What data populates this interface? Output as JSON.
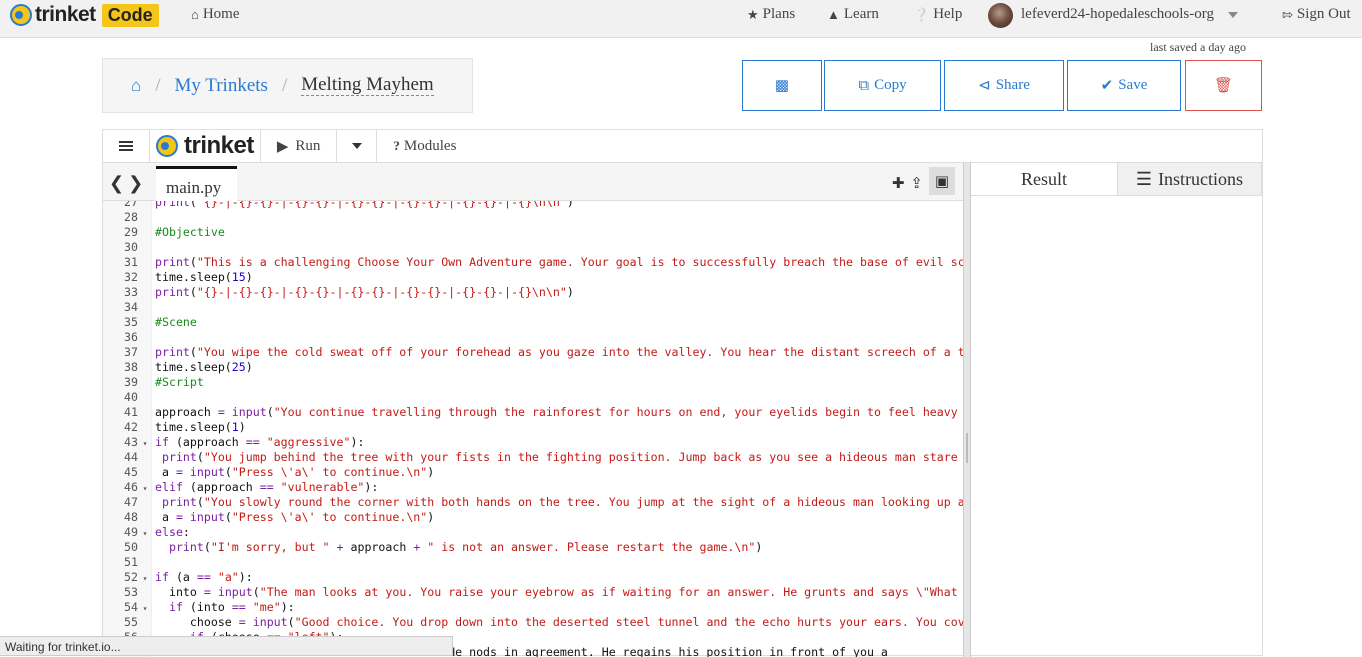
{
  "nav": {
    "brand": "trinket",
    "brand_badge": "Code",
    "home": "Home",
    "plans": "Plans",
    "learn": "Learn",
    "help": "Help",
    "user": "lefeverd24-hopedaleschools-org",
    "signout": "Sign Out"
  },
  "saved_text": "last saved a day ago",
  "breadcrumb": {
    "my_trinkets": "My Trinkets",
    "title": "Melting Mayhem"
  },
  "actions": {
    "copy": "Copy",
    "share": "Share",
    "save": "Save"
  },
  "toolbar": {
    "brand": "trinket",
    "run": "Run",
    "modules": "Modules"
  },
  "file_tab": "main.py",
  "right_tabs": {
    "result": "Result",
    "instructions": "Instructions"
  },
  "status": "Waiting for trinket.io...",
  "code_lines": [
    {
      "n": "27",
      "f": "",
      "t": "print(\"{}-|-{}-{}-|-{}-{}-|-{}-{}-|-{}-{}-|-{}-{}-|-{}\\n\\n\")"
    },
    {
      "n": "28",
      "f": "",
      "t": ""
    },
    {
      "n": "29",
      "f": "",
      "t": "#Objective"
    },
    {
      "n": "30",
      "f": "",
      "t": ""
    },
    {
      "n": "31",
      "f": "",
      "t": "print(\"This is a challenging Choose Your Own Adventure game. Your goal is to successfully breach the base of evil sc"
    },
    {
      "n": "32",
      "f": "",
      "t": "time.sleep(15)"
    },
    {
      "n": "33",
      "f": "",
      "t": "print(\"{}-|-{}-{}-|-{}-{}-|-{}-{}-|-{}-{}-|-{}-{}-|-{}\\n\\n\")"
    },
    {
      "n": "34",
      "f": "",
      "t": ""
    },
    {
      "n": "35",
      "f": "",
      "t": "#Scene"
    },
    {
      "n": "36",
      "f": "",
      "t": ""
    },
    {
      "n": "37",
      "f": "",
      "t": "print(\"You wipe the cold sweat off of your forehead as you gaze into the valley. You hear the distant screech of a t"
    },
    {
      "n": "38",
      "f": "",
      "t": "time.sleep(25)"
    },
    {
      "n": "39",
      "f": "",
      "t": "#Script"
    },
    {
      "n": "40",
      "f": "",
      "t": ""
    },
    {
      "n": "41",
      "f": "",
      "t": "approach = input(\"You continue travelling through the rainforest for hours on end, your eyelids begin to feel heavy"
    },
    {
      "n": "42",
      "f": "",
      "t": "time.sleep(1)"
    },
    {
      "n": "43",
      "f": "▾",
      "t": "if (approach == \"aggressive\"):"
    },
    {
      "n": "44",
      "f": "",
      "t": " print(\"You jump behind the tree with your fists in the fighting position. Jump back as you see a hideous man stare"
    },
    {
      "n": "45",
      "f": "",
      "t": " a = input(\"Press \\'a\\' to continue.\\n\")"
    },
    {
      "n": "46",
      "f": "▾",
      "t": "elif (approach == \"vulnerable\"):"
    },
    {
      "n": "47",
      "f": "",
      "t": " print(\"You slowly round the corner with both hands on the tree. You jump at the sight of a hideous man looking up a"
    },
    {
      "n": "48",
      "f": "",
      "t": " a = input(\"Press \\'a\\' to continue.\\n\")"
    },
    {
      "n": "49",
      "f": "▾",
      "t": "else:"
    },
    {
      "n": "50",
      "f": "",
      "t": "  print(\"I'm sorry, but \" + approach + \" is not an answer. Please restart the game.\\n\")"
    },
    {
      "n": "51",
      "f": "",
      "t": ""
    },
    {
      "n": "52",
      "f": "▾",
      "t": "if (a == \"a\"):"
    },
    {
      "n": "53",
      "f": "",
      "t": "  into = input(\"The man looks at you. You raise your eyebrow as if waiting for an answer. He grunts and says \\\"What"
    },
    {
      "n": "54",
      "f": "▾",
      "t": "  if (into == \"me\"):"
    },
    {
      "n": "55",
      "f": "",
      "t": "     choose = input(\"Good choice. You drop down into the deserted steel tunnel and the echo hurts your ears. You cov"
    },
    {
      "n": "56",
      "f": "▾",
      "t": "     if (choose == \"left\"):"
    },
    {
      "n": "57",
      "f": "",
      "t": "                                tell him. He nods in agreement. He regains his position in front of you a"
    }
  ]
}
